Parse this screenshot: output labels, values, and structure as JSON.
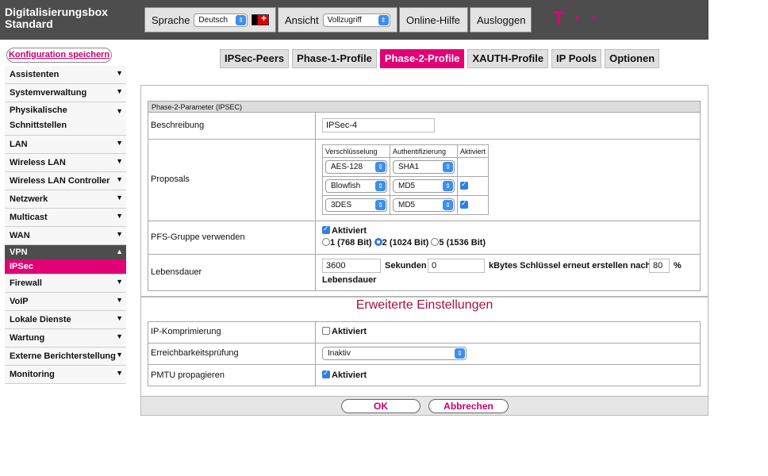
{
  "header": {
    "brand_line1": "Digitalisierungsbox",
    "brand_line2": "Standard",
    "language_label": "Sprache",
    "language_value": "Deutsch",
    "view_label": "Ansicht",
    "view_value": "Vollzugriff",
    "help": "Online-Hilfe",
    "logout": "Ausloggen",
    "logo": "T · ·"
  },
  "sidebar": {
    "save": "Konfiguration speichern",
    "items": [
      {
        "label": "Assistenten"
      },
      {
        "label": "Systemverwaltung"
      },
      {
        "label": "Physikalische Schnittstellen"
      },
      {
        "label": "LAN"
      },
      {
        "label": "Wireless LAN"
      },
      {
        "label": "Wireless LAN Controller"
      },
      {
        "label": "Netzwerk"
      },
      {
        "label": "Multicast"
      },
      {
        "label": "WAN"
      },
      {
        "label": "VPN"
      },
      {
        "label": "IPSec"
      },
      {
        "label": "Firewall"
      },
      {
        "label": "VoIP"
      },
      {
        "label": "Lokale Dienste"
      },
      {
        "label": "Wartung"
      },
      {
        "label": "Externe Berichterstellung"
      },
      {
        "label": "Monitoring"
      }
    ]
  },
  "tabs": [
    "IPSec-Peers",
    "Phase-1-Profile",
    "Phase-2-Profile",
    "XAUTH-Profile",
    "IP Pools",
    "Optionen"
  ],
  "form": {
    "section_title": "Phase-2-Parameter (IPSEC)",
    "description_label": "Beschreibung",
    "description_value": "IPSec-4",
    "proposals_label": "Proposals",
    "proposals_headers": [
      "Verschlüsselung",
      "Authentifizierung",
      "Aktiviert"
    ],
    "proposals": [
      {
        "enc": "AES-128",
        "auth": "SHA1"
      },
      {
        "enc": "Blowfish",
        "auth": "MD5"
      },
      {
        "enc": "3DES",
        "auth": "MD5"
      }
    ],
    "pfs_label": "PFS-Gruppe verwenden",
    "pfs_enabled": "Aktiviert",
    "pfs_opt1": "1 (768 Bit)",
    "pfs_opt2": "2 (1024 Bit)",
    "pfs_opt3": "5 (1536 Bit)",
    "lifetime_label": "Lebensdauer",
    "lifetime_seconds": "3600",
    "seconds_label": "Sekunden",
    "lifetime_kbytes": "0",
    "kbytes_label": "kBytes Schlüssel erneut erstellen nach",
    "renew_percent": "80",
    "percent_sign": "%",
    "lifetime_suffix": "Lebensdauer"
  },
  "advanced": {
    "title": "Erweiterte Einstellungen",
    "ipcomp_label": "IP-Komprimierung",
    "ipcomp_value": "Aktiviert",
    "reach_label": "Erreichbarkeitsprüfung",
    "reach_value": "Inaktiv",
    "pmtu_label": "PMTU propagieren",
    "pmtu_value": "Aktiviert"
  },
  "footer": {
    "ok": "OK",
    "cancel": "Abbrechen"
  },
  "colors": {
    "brand": "#e20074",
    "header_bg": "#4d4d4d",
    "accent_blue": "#2f7fe0"
  }
}
